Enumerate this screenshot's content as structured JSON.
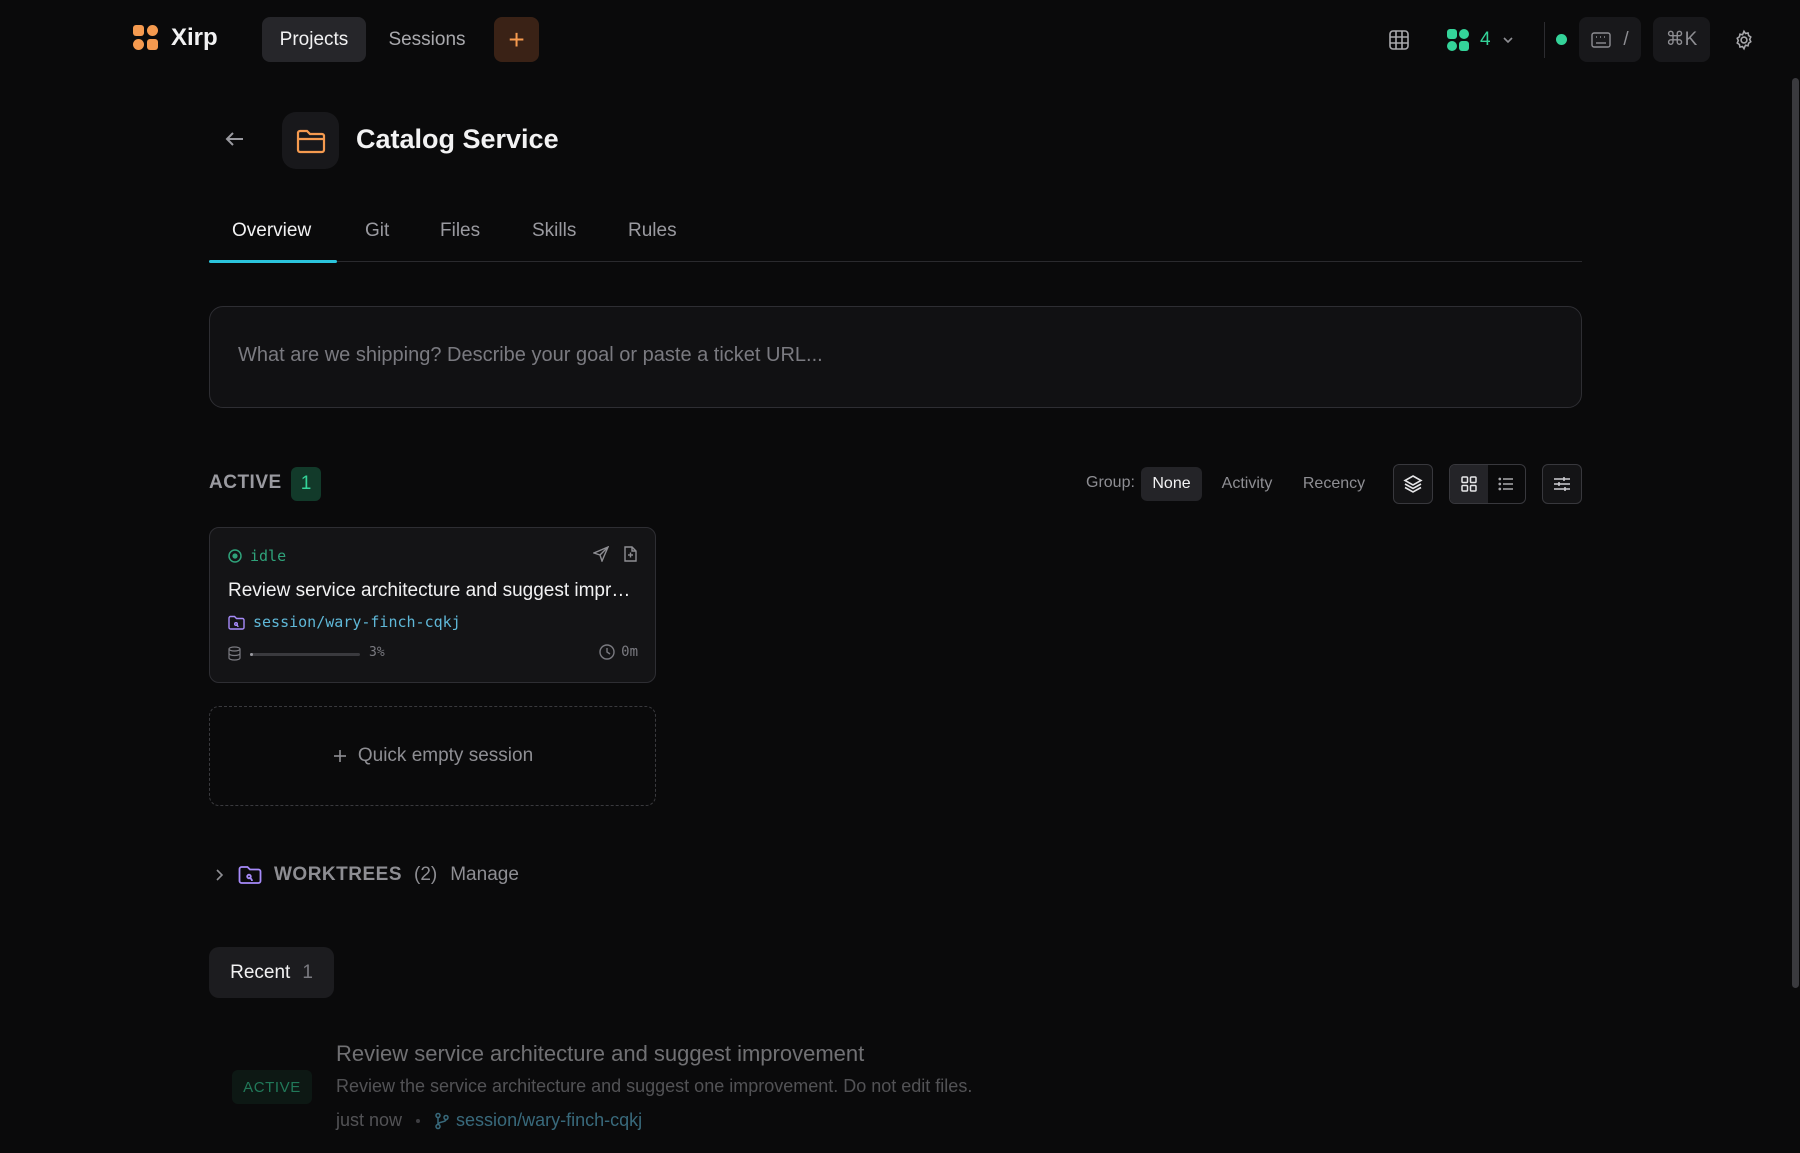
{
  "app": {
    "name": "Xirp"
  },
  "nav": {
    "projects": "Projects",
    "sessions": "Sessions",
    "new_symbol": "+",
    "agents_count": "4",
    "kbd_shortcuts": "/",
    "command_palette": "⌘K"
  },
  "project": {
    "title": "Catalog Service",
    "tabs": [
      "Overview",
      "Git",
      "Files",
      "Skills",
      "Rules"
    ],
    "active_tab": "Overview"
  },
  "goal": {
    "placeholder": "What are we shipping? Describe your goal or paste a ticket URL..."
  },
  "active": {
    "label": "ACTIVE",
    "count": "1",
    "group_label": "Group:",
    "group_options": [
      "None",
      "Activity",
      "Recency"
    ],
    "group_selected": "None"
  },
  "session_card": {
    "status": "idle",
    "title": "Review service architecture and suggest improvement",
    "branch": "session/wary-finch-cqkj",
    "context_percent": 3,
    "context_label": "3%",
    "elapsed": "0m"
  },
  "quick_session": {
    "label": "Quick empty session"
  },
  "worktrees": {
    "label": "WORKTREES",
    "count": "(2)",
    "manage": "Manage"
  },
  "recent": {
    "label": "Recent",
    "count": "1",
    "items": [
      {
        "badge": "ACTIVE",
        "title": "Review service architecture and suggest improvement",
        "description": "Review the service architecture and suggest one improvement. Do not edit files.",
        "time": "just now",
        "branch": "session/wary-finch-cqkj"
      }
    ]
  },
  "colors": {
    "accent_orange": "#f59a4f",
    "accent_green": "#34d399",
    "accent_cyan": "#2bc4dc",
    "branch_blue": "#5fb8d8",
    "worktree_purple": "#a78bfa"
  }
}
